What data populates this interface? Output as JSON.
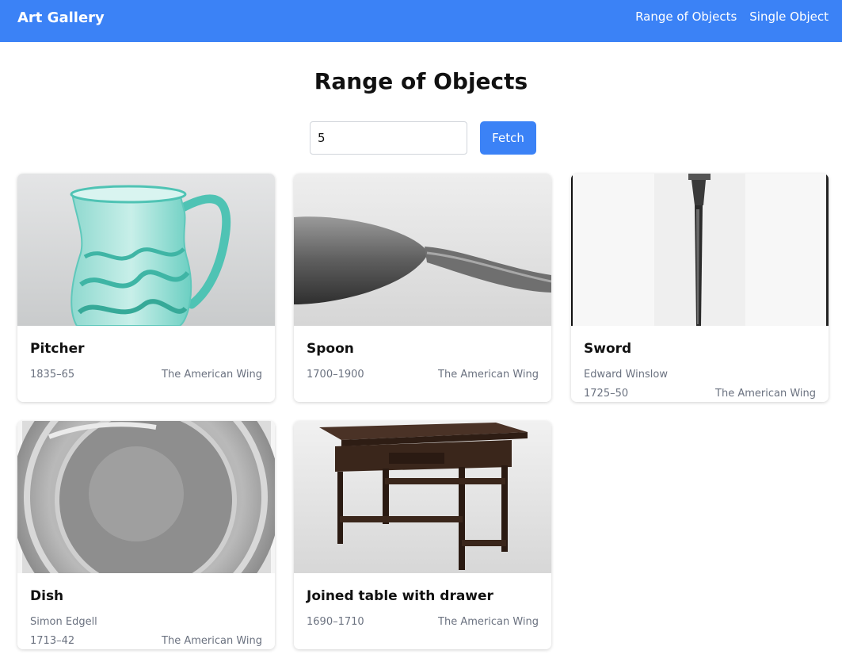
{
  "navbar": {
    "brand": "Art Gallery",
    "links": [
      "Range of Objects",
      "Single Object"
    ],
    "background": "#3b82f6"
  },
  "page": {
    "title": "Range of Objects"
  },
  "range_input": {
    "value": "5"
  },
  "fetch_button": {
    "label": "Fetch",
    "color": "#3b82f6"
  },
  "objects": [
    {
      "title": "Pitcher",
      "artist": "",
      "date": "1835–65",
      "department": "The American Wing"
    },
    {
      "title": "Spoon",
      "artist": "",
      "date": "1700–1900",
      "department": "The American Wing"
    },
    {
      "title": "Sword",
      "artist": "Edward Winslow",
      "date": "1725–50",
      "department": "The American Wing"
    },
    {
      "title": "Dish",
      "artist": "Simon Edgell",
      "date": "1713–42",
      "department": "The American Wing"
    },
    {
      "title": "Joined table with drawer",
      "artist": "",
      "date": "1690–1710",
      "department": "The American Wing"
    }
  ]
}
